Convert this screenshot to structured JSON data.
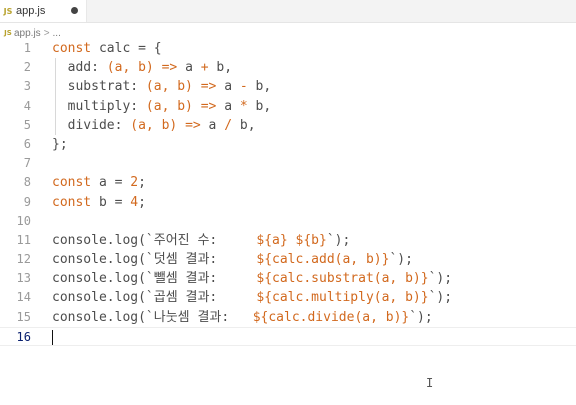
{
  "tab": {
    "filename": "app.js",
    "icon_text": "JS",
    "modified": true
  },
  "breadcrumb": {
    "icon_text": "JS",
    "file": "app.js",
    "separator": ">",
    "more": "..."
  },
  "editor": {
    "current_line": 16,
    "lines": [
      {
        "n": "1",
        "text": "const calc = {"
      },
      {
        "n": "2",
        "text": "  add: (a, b) => a + b,"
      },
      {
        "n": "3",
        "text": "  substrat: (a, b) => a - b,"
      },
      {
        "n": "4",
        "text": "  multiply: (a, b) => a * b,"
      },
      {
        "n": "5",
        "text": "  divide: (a, b) => a / b,"
      },
      {
        "n": "6",
        "text": "};"
      },
      {
        "n": "7",
        "text": ""
      },
      {
        "n": "8",
        "text": "const a = 2;"
      },
      {
        "n": "9",
        "text": "const b = 4;"
      },
      {
        "n": "10",
        "text": ""
      },
      {
        "n": "11",
        "text": "console.log(`주어진 수:     ${a} ${b}`);"
      },
      {
        "n": "12",
        "text": "console.log(`덧셈 결과:     ${calc.add(a, b)}`);"
      },
      {
        "n": "13",
        "text": "console.log(`뺄셈 결과:     ${calc.substrat(a, b)}`);"
      },
      {
        "n": "14",
        "text": "console.log(`곱셈 결과:     ${calc.multiply(a, b)}`);"
      },
      {
        "n": "15",
        "text": "console.log(`나눗셈 결과:   ${calc.divide(a, b)}`);"
      },
      {
        "n": "16",
        "text": ""
      }
    ]
  },
  "colors": {
    "keyword": "#d2691e",
    "tab_active": "#ffffff",
    "tabbar": "#f3f3f3"
  },
  "icons": {
    "tab_icon": "javascript-file-icon",
    "mouse_cursor": "text-cursor-icon",
    "dirty": "unsaved-dot-icon"
  }
}
